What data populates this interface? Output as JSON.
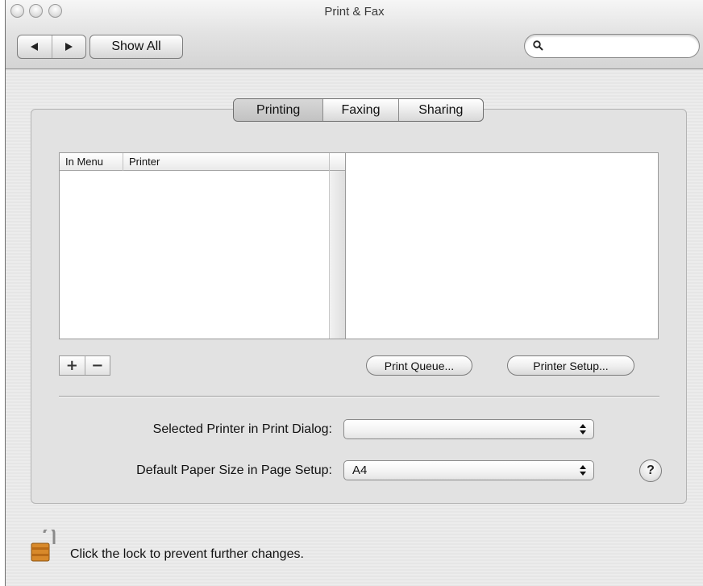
{
  "window": {
    "title": "Print & Fax"
  },
  "toolbar": {
    "back_label": "back",
    "forward_label": "forward",
    "show_all_label": "Show All",
    "search_placeholder": ""
  },
  "tabs": [
    {
      "label": "Printing",
      "active": true
    },
    {
      "label": "Faxing",
      "active": false
    },
    {
      "label": "Sharing",
      "active": false
    }
  ],
  "printer_list": {
    "columns": [
      "In Menu",
      "Printer"
    ],
    "rows": []
  },
  "buttons": {
    "add": "+",
    "remove": "−",
    "print_queue": "Print Queue...",
    "printer_setup": "Printer Setup..."
  },
  "settings": {
    "selected_printer_label": "Selected Printer in Print Dialog:",
    "selected_printer_value": "",
    "paper_size_label": "Default Paper Size in Page Setup:",
    "paper_size_value": "A4"
  },
  "help": "?",
  "lock": {
    "text": "Click the lock to prevent further changes."
  }
}
